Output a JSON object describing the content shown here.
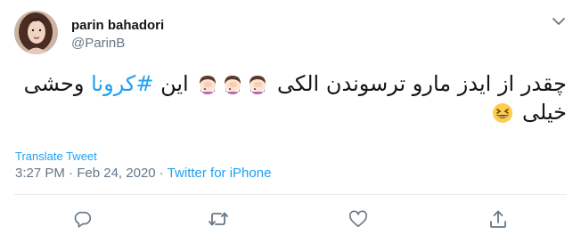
{
  "author": {
    "display_name": "parin bahadori",
    "handle": "@ParinB",
    "avatar_icon": "profile-photo"
  },
  "tweet": {
    "line1_pre": "چقدر از ایدز مارو ترسوندن الکی ",
    "line1_mid": " این ",
    "hashtag": "#کرونا",
    "line1_post": " وحشی",
    "line2": "خیلی ",
    "emojis": [
      "face-palm-woman",
      "face-palm-woman",
      "face-palm-woman",
      "grinning-squinting-face"
    ]
  },
  "translate_label": "Translate Tweet",
  "meta": {
    "time": "3:27 PM",
    "separator": " · ",
    "date": "Feb 24, 2020",
    "source": "Twitter for iPhone"
  },
  "colors": {
    "accent": "#1da1f2",
    "muted": "#657786",
    "text": "#14171a",
    "divider": "#e6ecf0"
  },
  "actions": [
    "reply-icon",
    "retweet-icon",
    "like-icon",
    "share-icon"
  ]
}
